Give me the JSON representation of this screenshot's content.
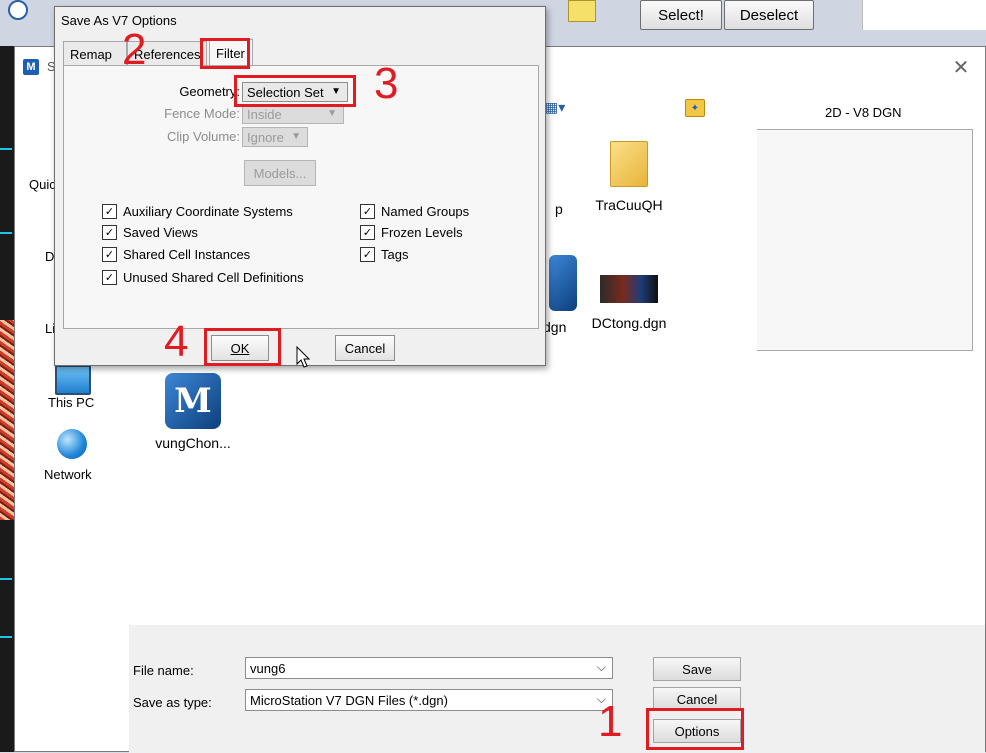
{
  "toolbar": {
    "select_label": "Select!",
    "deselect_label": "Deselect"
  },
  "save_dialog": {
    "title": "S",
    "nav": {
      "quick_access": "Quic",
      "desktop": "D",
      "libraries": "Li",
      "this_pc": "This PC",
      "network": "Network"
    },
    "files": [
      {
        "name": "TraCuuQH",
        "type": "folder"
      },
      {
        "name": "p",
        "type": "partial"
      },
      {
        "name": "dgn",
        "type": "partial"
      },
      {
        "name": "DCtong.dgn",
        "type": "dgn-thumb"
      },
      {
        "name": "vungChon...",
        "type": "microstation"
      }
    ],
    "preview_label": "2D - V8 DGN",
    "file_name_label": "File name:",
    "file_name_value": "vung6",
    "save_type_label": "Save as type:",
    "save_type_value": "MicroStation V7 DGN Files (*.dgn)",
    "save_button": "Save",
    "cancel_button": "Cancel",
    "options_button": "Options"
  },
  "options_dialog": {
    "title": "Save As V7 Options",
    "tabs": [
      "Remap",
      "References",
      "Filter"
    ],
    "active_tab": "Filter",
    "geometry_label": "Geometry:",
    "geometry_value": "Selection Set",
    "fence_mode_label": "Fence Mode:",
    "fence_mode_value": "Inside",
    "clip_volume_label": "Clip Volume:",
    "clip_volume_value": "Ignore",
    "models_button": "Models...",
    "checkboxes_left": [
      {
        "label": "Auxiliary Coordinate Systems",
        "checked": true
      },
      {
        "label": "Saved Views",
        "checked": true
      },
      {
        "label": "Shared Cell Instances",
        "checked": true
      },
      {
        "label": "Unused Shared Cell Definitions",
        "checked": true
      }
    ],
    "checkboxes_right": [
      {
        "label": "Named Groups",
        "checked": true
      },
      {
        "label": "Frozen Levels",
        "checked": true
      },
      {
        "label": "Tags",
        "checked": true
      }
    ],
    "ok_button": "OK",
    "cancel_button": "Cancel"
  },
  "annotations": {
    "step1": "1",
    "step2": "2",
    "step3": "3",
    "step4": "4"
  },
  "colors": {
    "highlight": "#e11b22",
    "accent": "#1c5fb5"
  }
}
